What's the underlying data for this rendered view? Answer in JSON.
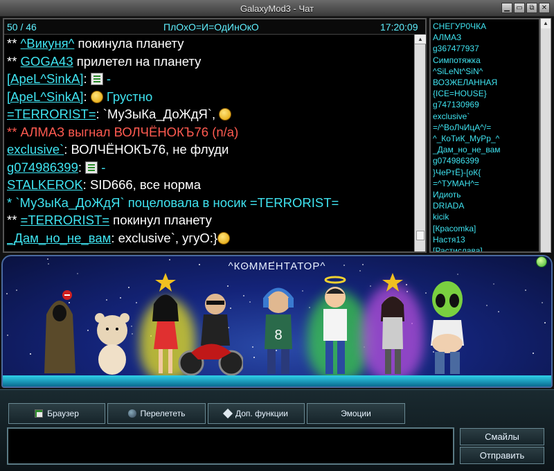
{
  "window": {
    "title": "GalaxyMod3 - Чат"
  },
  "status": {
    "counter": "50 / 46",
    "room_name": "ПлОхО=И=ОдИнОкО",
    "time": "17:20:09"
  },
  "messages": [
    {
      "prefix": "** ",
      "nick": "^Викуня^",
      "text": " покинула планету"
    },
    {
      "prefix": "** ",
      "nick": "GOGA43",
      "text": " прилетел на планету"
    },
    {
      "nick": "[ApeL^SinkA]",
      "text": ": ",
      "emote": "chat",
      "after": " -"
    },
    {
      "nick": "[ApeL^SinkA]",
      "text": ": ",
      "emote": "sad",
      "after": " Грустно"
    },
    {
      "nick": "=TERRORIST=",
      "text": ": `МуЗыКа_ДоЖдЯ`, ",
      "emote": "smile"
    },
    {
      "system_red": "** АЛМАЗ выгнал ВОЛЧЁНОКЪ76 (n/a)"
    },
    {
      "nick": "exclusive`",
      "text": ": ВОЛЧЁНОКЪ76, не флуди"
    },
    {
      "nick": "g074986399",
      "text": ": ",
      "emote": "chat",
      "after": " -"
    },
    {
      "nick": "STALKEROK",
      "text": ": SID666, все норма"
    },
    {
      "system_aqua": "* `МуЗыКа_ДоЖдЯ` поцеловала в носик =TERRORIST="
    },
    {
      "prefix": "** ",
      "nick": "=TERRORIST=",
      "text": " покинул планету"
    },
    {
      "nick": "_Дам_но_не_вам",
      "text": ": exclusive`, угуО:}",
      "emote": "grin"
    }
  ],
  "users": [
    "СНЕГУР0ЧКА",
    "АЛМАЗ",
    "g367477937",
    "Симпотяжка",
    "^SiLeNt^SiN^",
    "ВОЗЖЕЛАННАЯ",
    "{ICE=HOUSE}",
    "g747130969",
    "exclusive`",
    "=/^ВоЛчИцА^/=",
    "^_КоТиК_МуРр_^",
    "_Дам_но_не_вам",
    "g074986399",
    "}ЧеРтЁ}-[оК{",
    "=^ТУМАН^=",
    "Идиоть",
    "DRIADA",
    "kicik",
    "[Красomka]",
    "Настя13",
    "[Растислава]"
  ],
  "banner": {
    "title": "^КОММЕНТАТОР^"
  },
  "toolbar": {
    "browser": "Браузер",
    "fly": "Перелететь",
    "extra": "Доп. функции",
    "emotions": "Эмоции"
  },
  "actions": {
    "smiles": "Смайлы",
    "send": "Отправить"
  },
  "colors": {
    "nick": "#3fe3f0",
    "system_red": "#ff5a50",
    "accent": "#3fe3f0"
  }
}
